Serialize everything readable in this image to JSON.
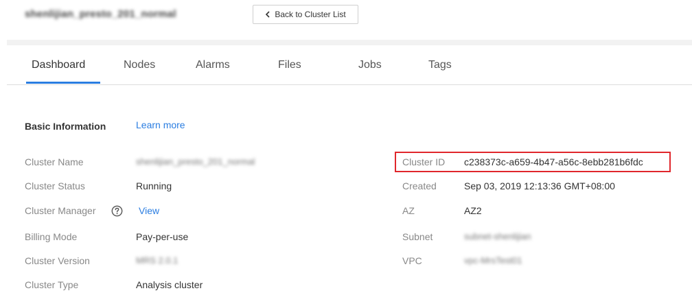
{
  "header": {
    "cluster_name": "shenlijian_presto_201_normal",
    "back_button_label": "Back to Cluster List"
  },
  "tabs": [
    {
      "label": "Dashboard",
      "active": true
    },
    {
      "label": "Nodes"
    },
    {
      "label": "Alarms"
    },
    {
      "label": "Files"
    },
    {
      "label": "Jobs"
    },
    {
      "label": "Tags"
    }
  ],
  "basic_info": {
    "title": "Basic Information",
    "learn_more": "Learn more",
    "left": [
      {
        "label": "Cluster Name",
        "value": "shenlijian_presto_201_normal",
        "redacted": true
      },
      {
        "label": "Cluster Status",
        "value": "Running"
      },
      {
        "label": "Cluster Manager",
        "value": "View",
        "link": true,
        "help_icon": "question-circle-icon"
      },
      {
        "label": "Billing Mode",
        "value": "Pay-per-use"
      },
      {
        "label": "Cluster Version",
        "value": "MRS 2.0.1",
        "redacted": true
      },
      {
        "label": "Cluster Type",
        "value": "Analysis cluster"
      }
    ],
    "right": [
      {
        "label": "Cluster ID",
        "value": "c238373c-a659-4b47-a56c-8ebb281b6fdc",
        "highlighted": true
      },
      {
        "label": "Created",
        "value": "Sep 03, 2019 12:13:36 GMT+08:00"
      },
      {
        "label": "AZ",
        "value": "AZ2"
      },
      {
        "label": "Subnet",
        "value": "subnet-shenlijian",
        "redacted": true
      },
      {
        "label": "VPC",
        "value": "vpc-MrsTest01",
        "redacted": true
      }
    ]
  },
  "colors": {
    "accent": "#2a7de1",
    "highlight": "#e0262b"
  }
}
